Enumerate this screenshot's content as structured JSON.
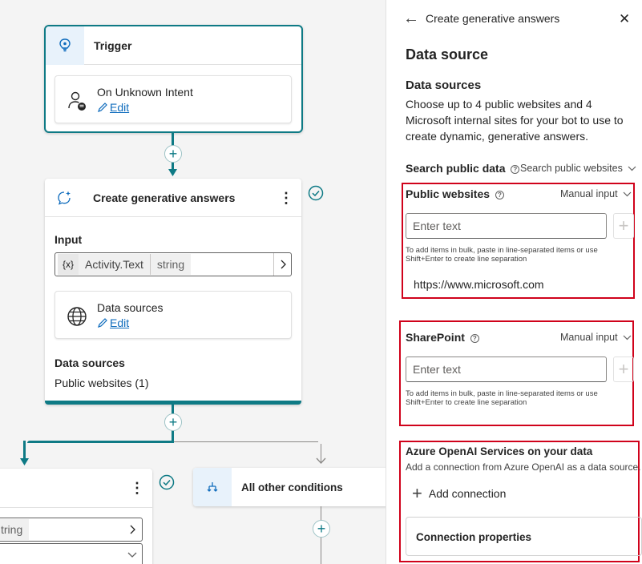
{
  "canvas": {
    "trigger": {
      "title": "Trigger",
      "intent": "On Unknown Intent",
      "edit": "Edit"
    },
    "gen_node": {
      "title": "Create generative answers",
      "more": "⋮",
      "input_label": "Input",
      "var_badge": "{x}",
      "var_name": "Activity.Text",
      "var_type": "string",
      "ds_title": "Data sources",
      "ds_edit": "Edit",
      "ds_section_label": "Data sources",
      "ds_value": "Public websites (1)"
    },
    "plus_symbol": "+",
    "left_branch": {
      "more": "⋮",
      "type_text": "tring"
    },
    "other_conditions": {
      "title": "All other conditions"
    }
  },
  "panel": {
    "back_icon": "←",
    "header_title": "Create generative answers",
    "close_icon": "✕",
    "section_title": "Data source",
    "data_sources_heading": "Data sources",
    "data_sources_desc": "Choose up to 4 public websites and 4 Microsoft internal sites for your bot to use to create dynamic, generative answers.",
    "search_public_label": "Search public data",
    "search_public_value": "Search public websites",
    "public_websites": {
      "label": "Public websites",
      "mode": "Manual input",
      "placeholder": "Enter text",
      "hint": "To add items in bulk, paste in line-separated items or use Shift+Enter to create line separation",
      "items": [
        "https://www.microsoft.com"
      ]
    },
    "sharepoint": {
      "label": "SharePoint",
      "mode": "Manual input",
      "placeholder": "Enter text",
      "hint": "To add items in bulk, paste in line-separated items or use Shift+Enter to create line separation"
    },
    "azure": {
      "title": "Azure OpenAI Services on your data",
      "desc": "Add a connection from Azure OpenAI as a data source.",
      "add_connection": "Add connection",
      "connection_properties": "Connection properties"
    }
  },
  "colors": {
    "accent": "#0e7a85",
    "link": "#0f6cbd",
    "highlight": "#d0021b",
    "success": "#0e7a85"
  }
}
